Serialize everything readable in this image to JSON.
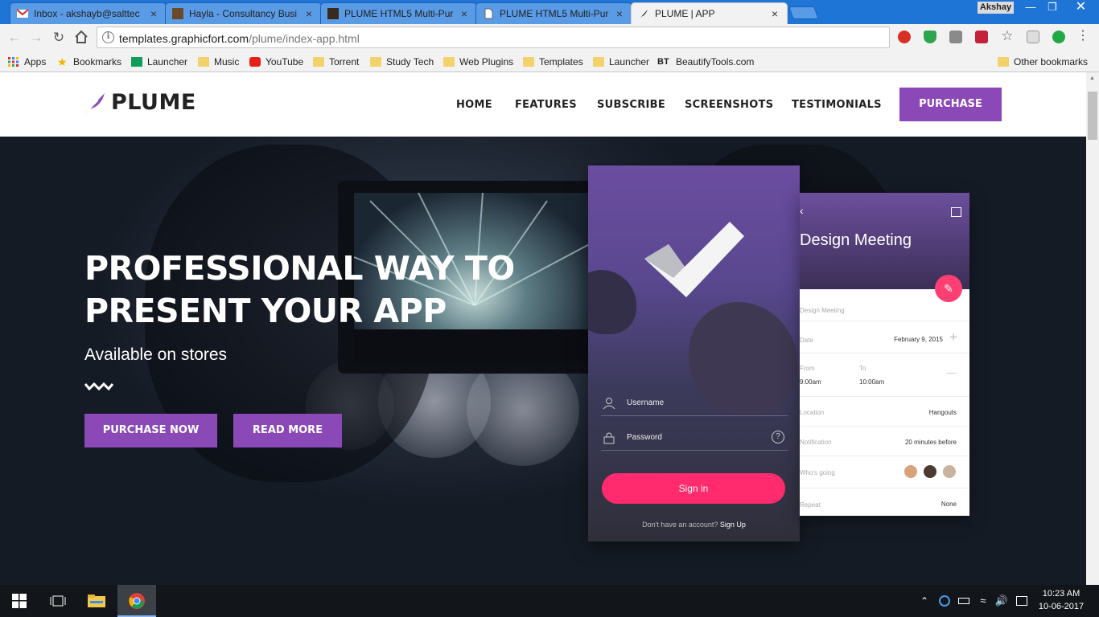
{
  "browser": {
    "tabs": [
      {
        "title": "Inbox - akshayb@saltteс",
        "icon": "gmail-icon",
        "close": "×"
      },
      {
        "title": "Hayla - Consultancy Busi",
        "icon": "hayla-favicon",
        "close": "×"
      },
      {
        "title": "PLUME HTML5 Multi-Pur",
        "icon": "plume-favicon",
        "close": "×"
      },
      {
        "title": "PLUME HTML5 Multi-Pur",
        "icon": "document-icon",
        "close": "×"
      },
      {
        "title": "PLUME | APP",
        "icon": "feather-icon",
        "close": "×"
      }
    ],
    "active_tab": 4,
    "profile_name": "Akshay",
    "url_host": "templates.graphicfort.com",
    "url_path": "/plume/index-app.html",
    "bookmarks": [
      {
        "label": "Apps",
        "icon": "apps-grid-icon"
      },
      {
        "label": "Bookmarks",
        "icon": "star-icon"
      },
      {
        "label": "Launcher",
        "icon": "sheets-icon"
      },
      {
        "label": "Music",
        "icon": "folder-icon"
      },
      {
        "label": "YouTube",
        "icon": "youtube-icon"
      },
      {
        "label": "Torrent",
        "icon": "folder-icon"
      },
      {
        "label": "Study Tech",
        "icon": "folder-icon"
      },
      {
        "label": "Web Plugins",
        "icon": "folder-icon"
      },
      {
        "label": "Templates",
        "icon": "folder-icon"
      },
      {
        "label": "Launcher",
        "icon": "folder-icon"
      },
      {
        "label": "BeautifyTools.com",
        "icon": "bt-icon",
        "badge": "BT"
      }
    ],
    "other_bookmarks": "Other bookmarks"
  },
  "site": {
    "logo_text": "PLUME",
    "nav": [
      "HOME",
      "FEATURES",
      "SUBSCRIBE",
      "SCREENSHOTS",
      "TESTIMONIALS"
    ],
    "purchase_label": "PURCHASE",
    "accent_color": "#8a49b7"
  },
  "hero": {
    "title_line1": "PROFESSIONAL WAY TO",
    "title_line2": "PRESENT YOUR APP",
    "subtitle": "Available on stores",
    "primary_button": "PURCHASE NOW",
    "secondary_button": "READ MORE"
  },
  "login_mock": {
    "username": "Username",
    "password": "Password",
    "help": "?",
    "signin": "Sign in",
    "no_account": "Don't have an account?",
    "signup": "Sign Up",
    "signin_color": "#ff2b6e"
  },
  "event_mock": {
    "title": "Design Meeting",
    "name_field": "Design Meeting",
    "date_label": "Date",
    "date_value": "February 9, 2015",
    "from_label": "From",
    "from_value": "9:00am",
    "to_label": "To",
    "to_value": "10:00am",
    "location_label": "Location",
    "location_value": "Hangouts",
    "notification_label": "Notification",
    "notification_value": "20 minutes before",
    "going_label": "Who's going",
    "repeat_label": "Repeat",
    "repeat_value": "None"
  },
  "taskbar": {
    "time": "10:23 AM",
    "date": "10-06-2017"
  }
}
